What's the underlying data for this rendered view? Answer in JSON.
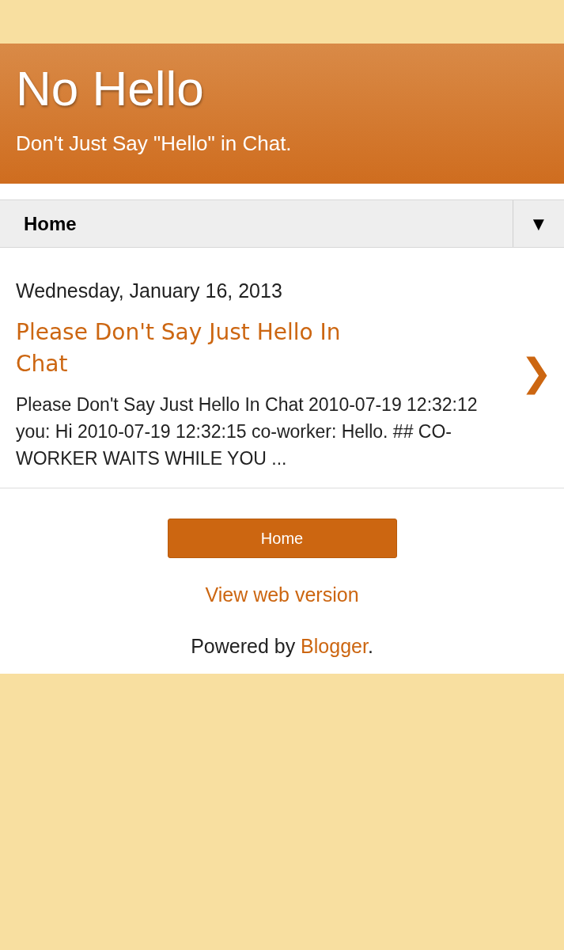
{
  "blog": {
    "title": "No Hello",
    "description": "Don't Just Say \"Hello\" in Chat."
  },
  "nav": {
    "label": "Home",
    "menu_glyph": "▼"
  },
  "post": {
    "date": "Wednesday, January 16, 2013",
    "title": "Please Don't Say Just Hello In Chat",
    "snippet": "Please Don't Say Just Hello In Chat 2010-07-19 12:32:12 you: Hi 2010-07-19 12:32:15 co-worker: Hello. ## CO-WORKER WAITS WHILE YOU ...",
    "next_glyph": "❯"
  },
  "footer": {
    "home_button": "Home",
    "web_version_link": "View web version",
    "powered_by": {
      "prefix": "Powered by",
      "link": "Blogger",
      "suffix": "."
    }
  }
}
